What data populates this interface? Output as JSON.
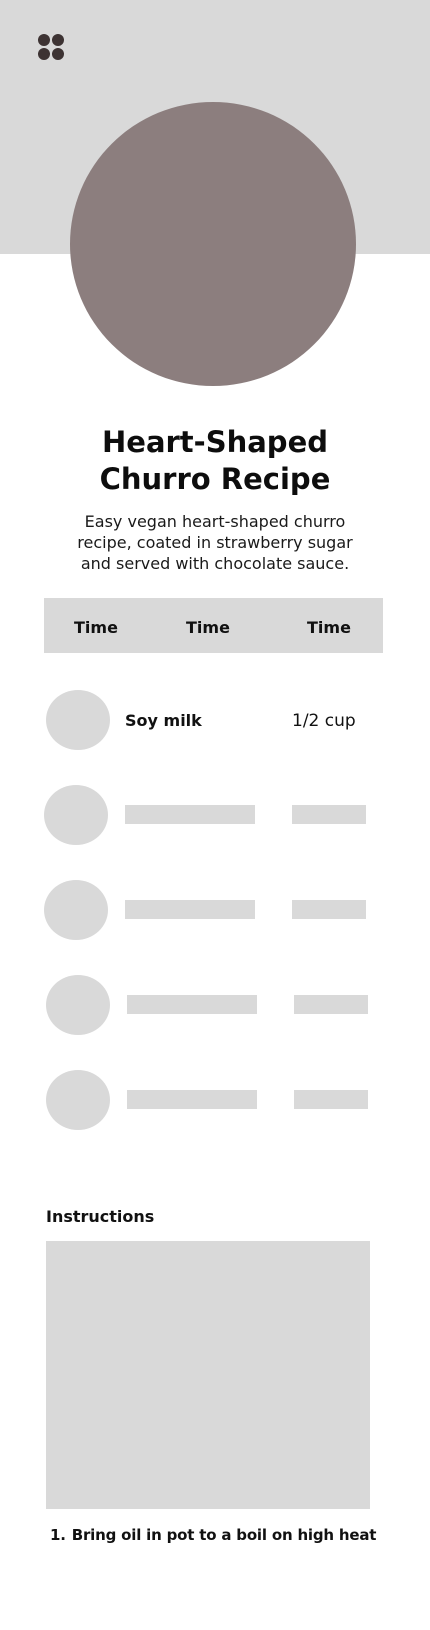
{
  "header": {
    "menu_icon": "grid-dots-icon",
    "background_color": "#d9d9d9",
    "hero_color": "#8c7e7e"
  },
  "recipe": {
    "title_line1": "Heart-Shaped",
    "title_line2": "Churro Recipe",
    "description": "Easy vegan heart-shaped churro recipe, coated in strawberry sugar and served with chocolate sauce."
  },
  "time_bar": {
    "labels": [
      "Time",
      "Time",
      "Time"
    ]
  },
  "ingredients": [
    {
      "name": "Soy milk",
      "quantity": "1/2 cup"
    }
  ],
  "instructions": {
    "heading": "Instructions",
    "steps": [
      {
        "number": "1.",
        "text": "Bring oil in pot to a boil on high heat"
      }
    ]
  }
}
